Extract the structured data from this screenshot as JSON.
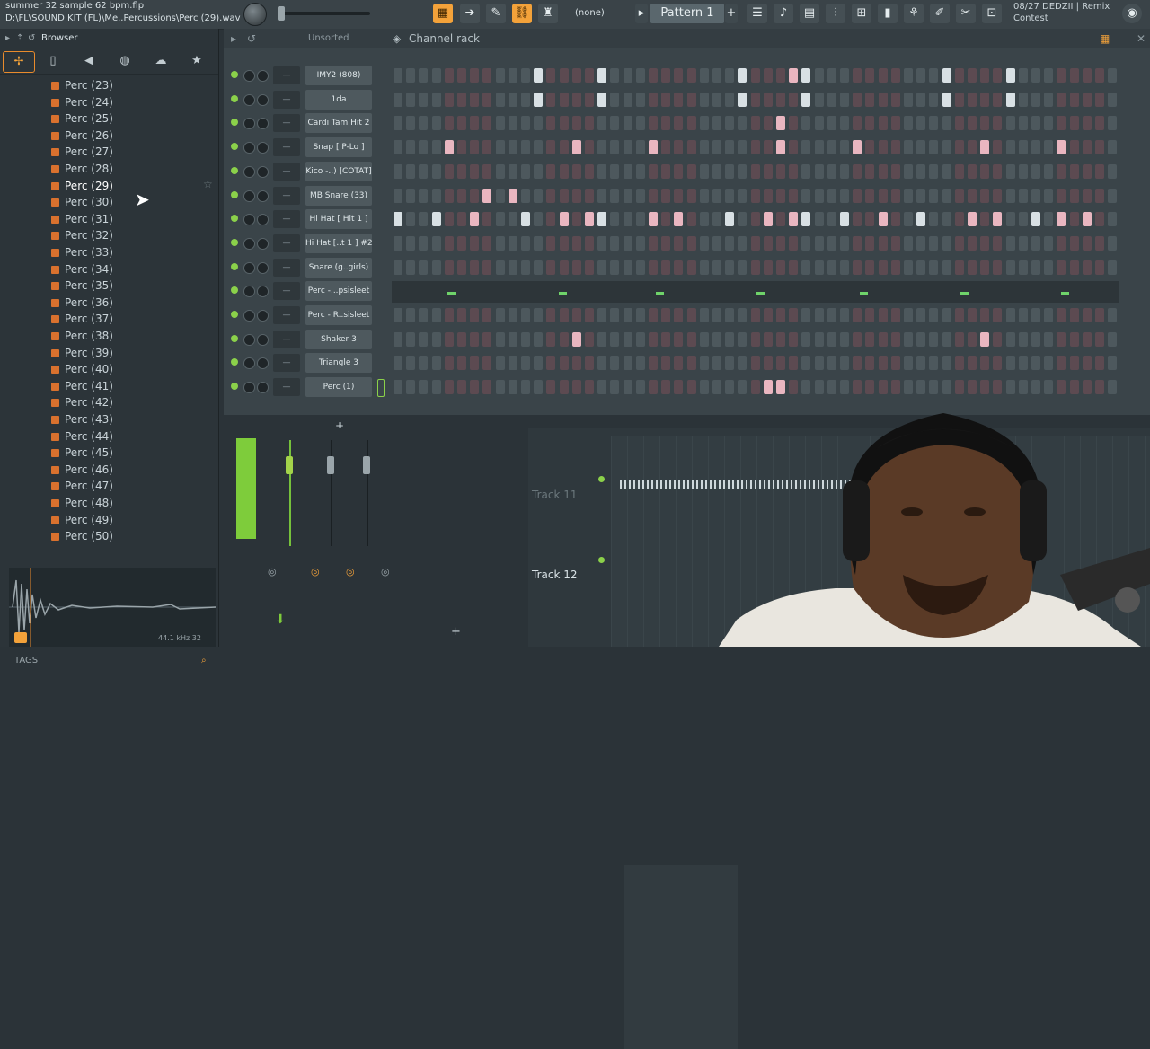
{
  "window": {
    "title_file": "summer 32 sample 62 bpm.flp",
    "title_path": "D:\\FL\\SOUND KIT (FL)\\Me..Percussions\\Perc (29).wav"
  },
  "toolbar": {
    "pattern_selector": "(none)",
    "pattern": "Pattern 1",
    "pattern_add": "+",
    "hint_line1": "08/27  DEDZII | Remix",
    "hint_line2": "Contest"
  },
  "browser": {
    "title": "Browser",
    "files": [
      "Perc (23)",
      "Perc (24)",
      "Perc (25)",
      "Perc (26)",
      "Perc (27)",
      "Perc (28)",
      "Perc (29)",
      "Perc (30)",
      "Perc (31)",
      "Perc (32)",
      "Perc (33)",
      "Perc (34)",
      "Perc (35)",
      "Perc (36)",
      "Perc (37)",
      "Perc (38)",
      "Perc (39)",
      "Perc (40)",
      "Perc (41)",
      "Perc (42)",
      "Perc (43)",
      "Perc (44)",
      "Perc (45)",
      "Perc (46)",
      "Perc (47)",
      "Perc (48)",
      "Perc (49)",
      "Perc (50)"
    ],
    "selected_index": 6,
    "sample_info": "44.1 kHz 32",
    "tags_label": "TAGS"
  },
  "channel_rack": {
    "filter": "Unsorted",
    "title": "Channel rack",
    "channels": [
      {
        "name": "IMY2 (808)",
        "steps": [
          11,
          16,
          27,
          31,
          32,
          43,
          48
        ]
      },
      {
        "name": "1da",
        "steps": [
          11,
          16,
          27,
          32,
          43,
          48
        ]
      },
      {
        "name": "Cardi Tam Hit 2",
        "steps": [
          30
        ]
      },
      {
        "name": "Snap [ P-Lo ]",
        "steps": [
          4,
          14,
          20,
          30,
          36,
          46,
          52
        ]
      },
      {
        "name": "Kico -..) [COTAT]",
        "steps": []
      },
      {
        "name": "MB Snare (33)",
        "steps": [
          7,
          9
        ]
      },
      {
        "name": "Hi Hat [ Hit 1 ]",
        "steps": [
          0,
          3,
          6,
          10,
          13,
          15,
          16,
          20,
          22,
          26,
          29,
          31,
          32,
          35,
          38,
          41,
          45,
          47,
          50,
          52,
          54
        ]
      },
      {
        "name": "Hi Hat [..t 1 ] #2",
        "steps": []
      },
      {
        "name": "Snare (g..girls)",
        "steps": []
      },
      {
        "name": "Perc -...psisleet",
        "steps": [],
        "piano_roll": true
      },
      {
        "name": "Perc - R..sisleet",
        "steps": []
      },
      {
        "name": "Shaker 3",
        "steps": [
          14,
          46
        ]
      },
      {
        "name": "Triangle 3",
        "steps": []
      },
      {
        "name": "Perc (1)",
        "steps": [
          29,
          30
        ]
      }
    ],
    "mute_ctl": "—",
    "add_channel": "+"
  },
  "playlist": {
    "tracks": [
      "Track 11",
      "Track 12"
    ]
  },
  "mixer": {
    "add": "+"
  },
  "colors": {
    "accent": "#f3a23a",
    "step_on": "#e9b6c0",
    "step_white": "#d8e0e4",
    "led": "#8bd14a"
  }
}
